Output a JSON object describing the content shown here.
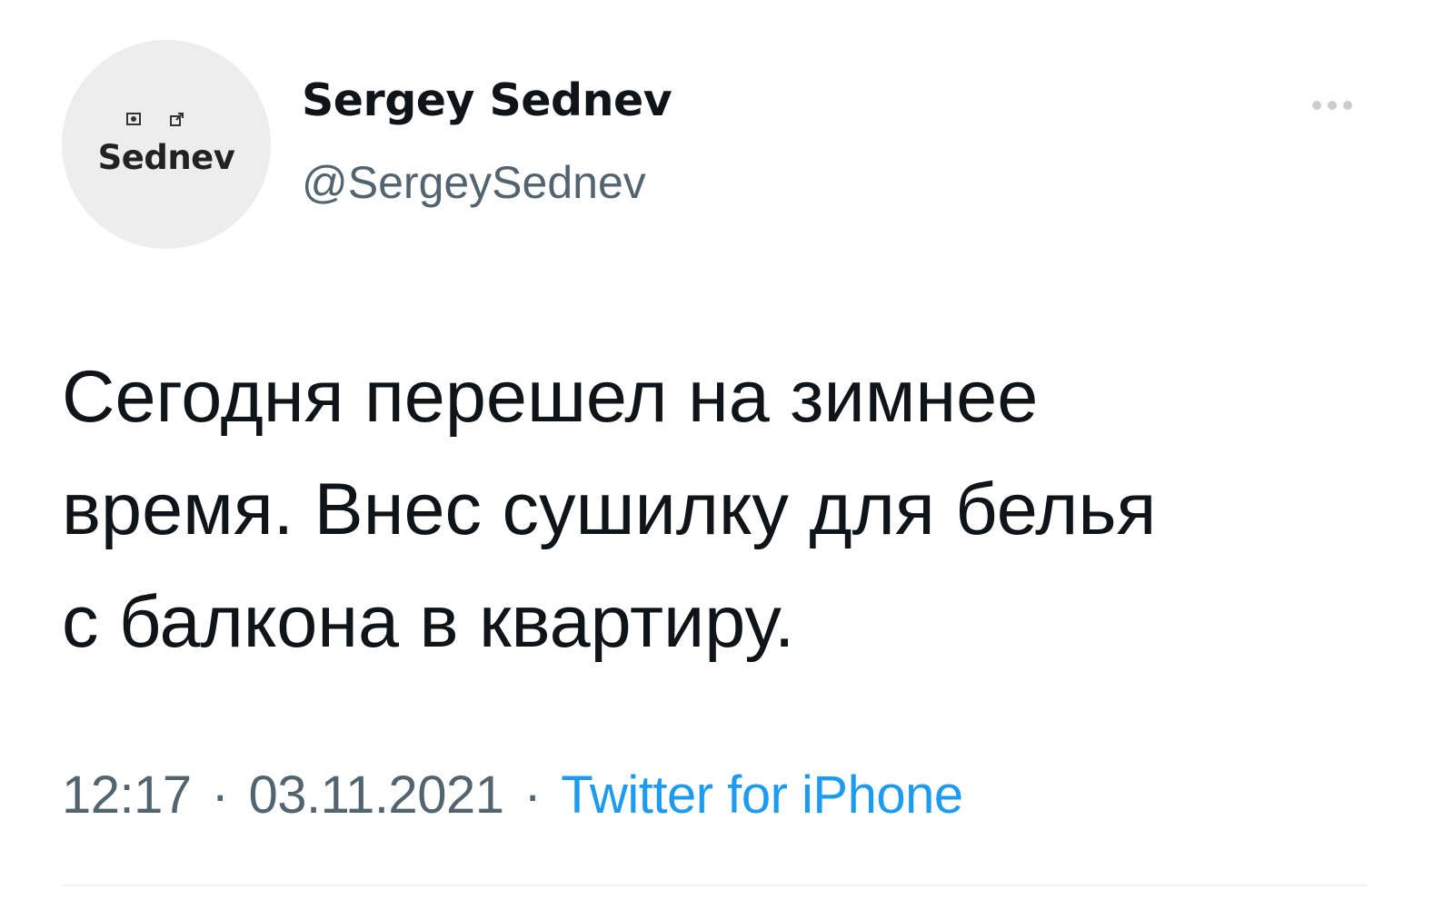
{
  "author": {
    "avatar": {
      "logo_text": "Sednev",
      "icons": [
        "camera-icon",
        "share-icon"
      ]
    },
    "display_name": "Sergey Sednev",
    "handle": "@SergeySednev"
  },
  "tweet": {
    "lines": [
      "Сегодня перешел на зимнее",
      "время. Внес сушилку для белья",
      "с балкона в квартиру."
    ],
    "time": "12:17",
    "date": "03.11.2021",
    "separator": "·",
    "source": "Twitter for iPhone"
  },
  "colors": {
    "text": "#0f1419",
    "secondary": "#536471",
    "link": "#1d9bf0",
    "avatar_bg": "#ededed",
    "divider": "#eff3f4"
  },
  "icons": {
    "more": "more-horizontal-icon"
  }
}
